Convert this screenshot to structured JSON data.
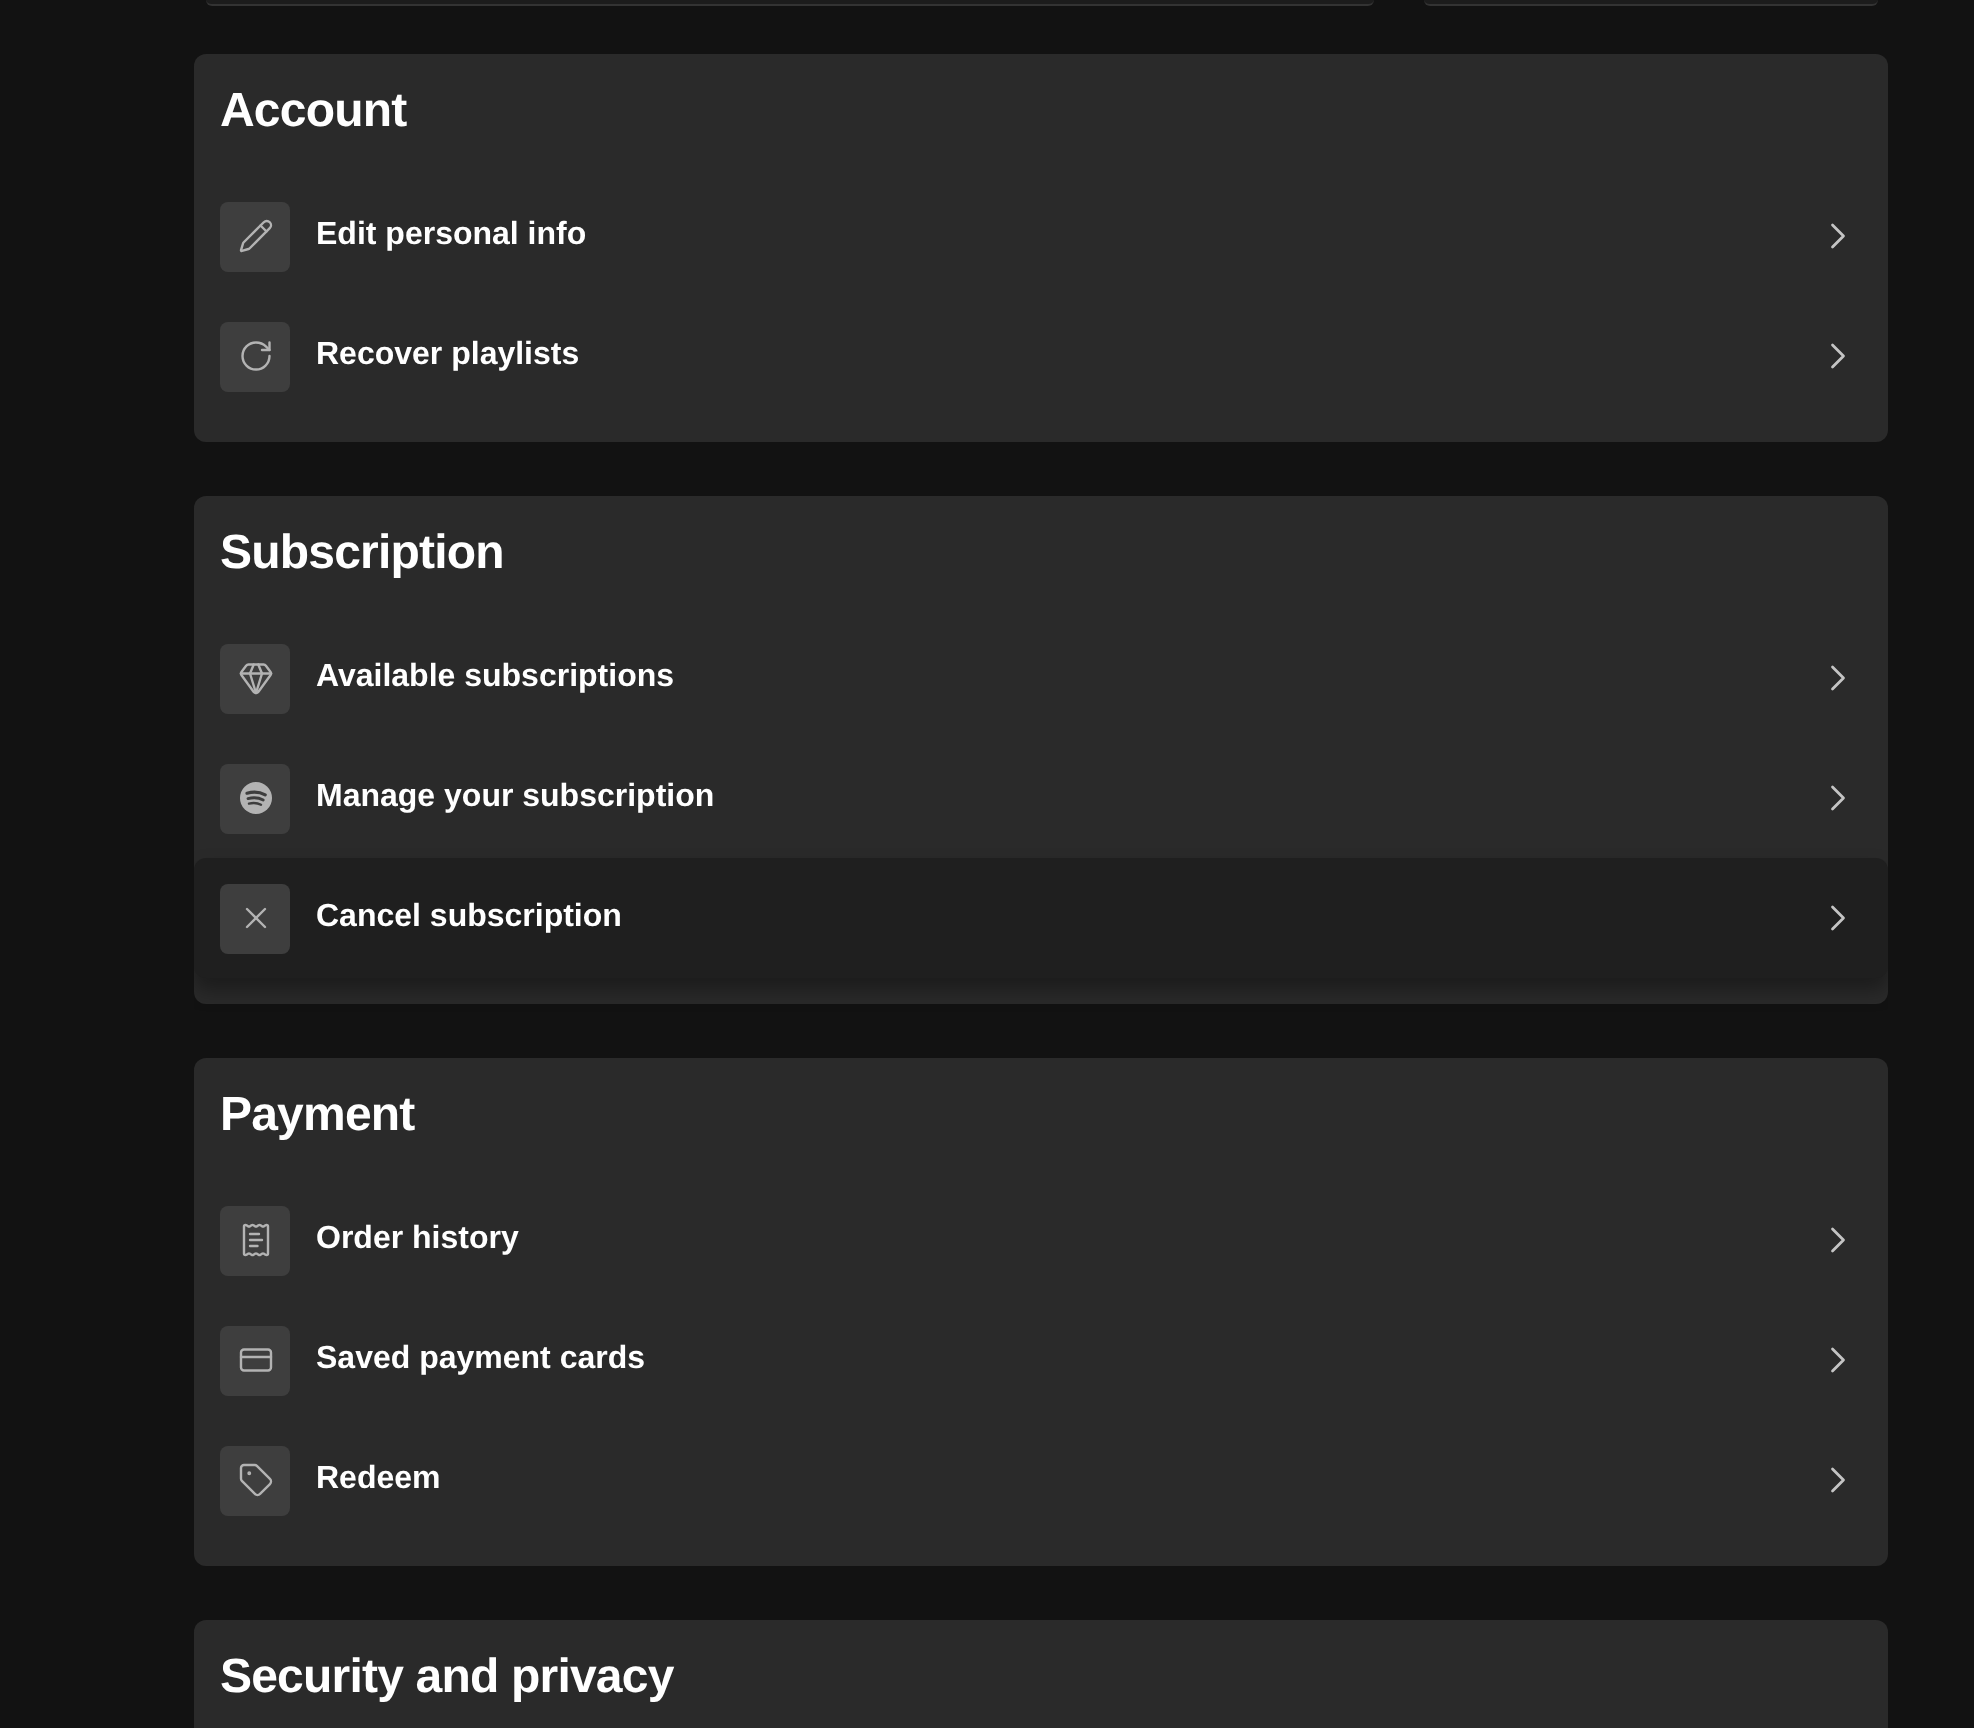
{
  "sections": [
    {
      "title": "Account",
      "items": [
        {
          "label": "Edit personal info",
          "hovered": false
        },
        {
          "label": "Recover playlists",
          "hovered": false
        }
      ]
    },
    {
      "title": "Subscription",
      "items": [
        {
          "label": "Available subscriptions",
          "hovered": false
        },
        {
          "label": "Manage your subscription",
          "hovered": false
        },
        {
          "label": "Cancel subscription",
          "hovered": true
        }
      ]
    },
    {
      "title": "Payment",
      "items": [
        {
          "label": "Order history",
          "hovered": false
        },
        {
          "label": "Saved payment cards",
          "hovered": false
        },
        {
          "label": "Redeem",
          "hovered": false
        }
      ]
    },
    {
      "title": "Security and privacy"
    }
  ]
}
